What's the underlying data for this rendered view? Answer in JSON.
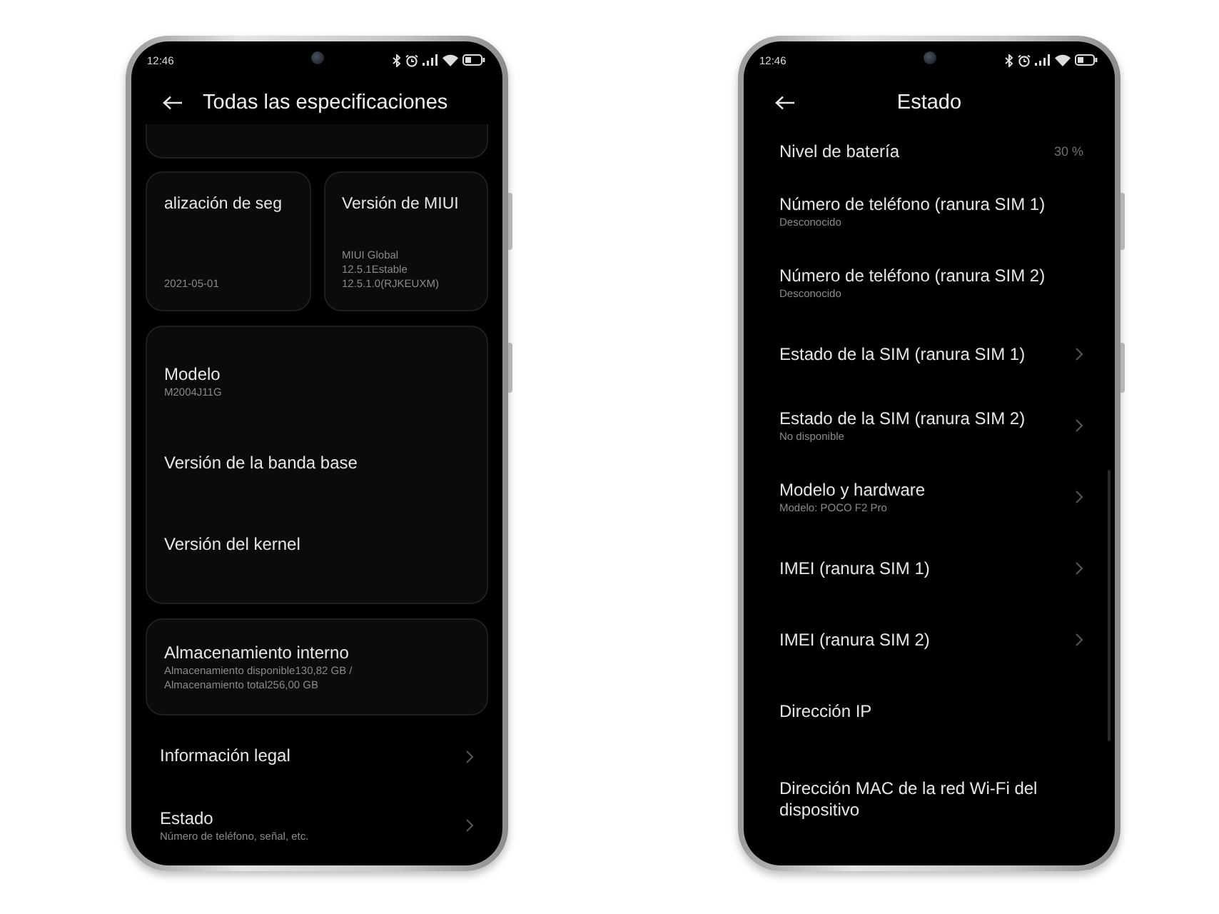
{
  "screens": [
    {
      "kind": "specs",
      "status_bar": {
        "time": "12:46"
      },
      "header": {
        "title": "Todas las especificaciones"
      },
      "cards": [
        {
          "title": "alización de seg",
          "lines": [
            "2021-05-01"
          ]
        },
        {
          "title": "Versión de MIUI",
          "lines": [
            "MIUI Global",
            "12.5.1Estable",
            "12.5.1.0(RJKEUXM)"
          ]
        }
      ],
      "group": [
        {
          "title": "Modelo",
          "subtitle": "M2004J11G"
        },
        {
          "title": "Versión de la banda base"
        },
        {
          "title": "Versión del kernel"
        }
      ],
      "storage": {
        "title": "Almacenamiento interno",
        "lines": [
          "Almacenamiento disponible130,82 GB /",
          "Almacenamiento total256,00 GB"
        ]
      },
      "items": [
        {
          "title": "Información legal",
          "arrow": true
        },
        {
          "title": "Estado",
          "subtitle": "Número de teléfono, señal, etc.",
          "arrow": true
        }
      ]
    },
    {
      "kind": "status",
      "status_bar": {
        "time": "12:46"
      },
      "header": {
        "title": "Estado"
      },
      "items": [
        {
          "title": "Nivel de batería",
          "value": "30 %",
          "arrow": false
        },
        {
          "title": "Número de teléfono (ranura SIM 1)",
          "subtitle": "Desconocido",
          "arrow": false
        },
        {
          "title": "Número de teléfono (ranura SIM 2)",
          "subtitle": "Desconocido",
          "arrow": false
        },
        {
          "title": "Estado de la SIM (ranura SIM 1)",
          "arrow": true
        },
        {
          "title": "Estado de la SIM (ranura SIM 2)",
          "subtitle": "No disponible",
          "arrow": true
        },
        {
          "title": "Modelo y hardware",
          "subtitle": "Modelo: POCO F2 Pro",
          "arrow": true
        },
        {
          "title": "IMEI (ranura SIM 1)",
          "arrow": true
        },
        {
          "title": "IMEI (ranura SIM 2)",
          "arrow": true
        },
        {
          "title": "Dirección IP",
          "arrow": false
        },
        {
          "title": "Dirección MAC de la red Wi-Fi del dispositivo",
          "arrow": false
        }
      ]
    }
  ]
}
